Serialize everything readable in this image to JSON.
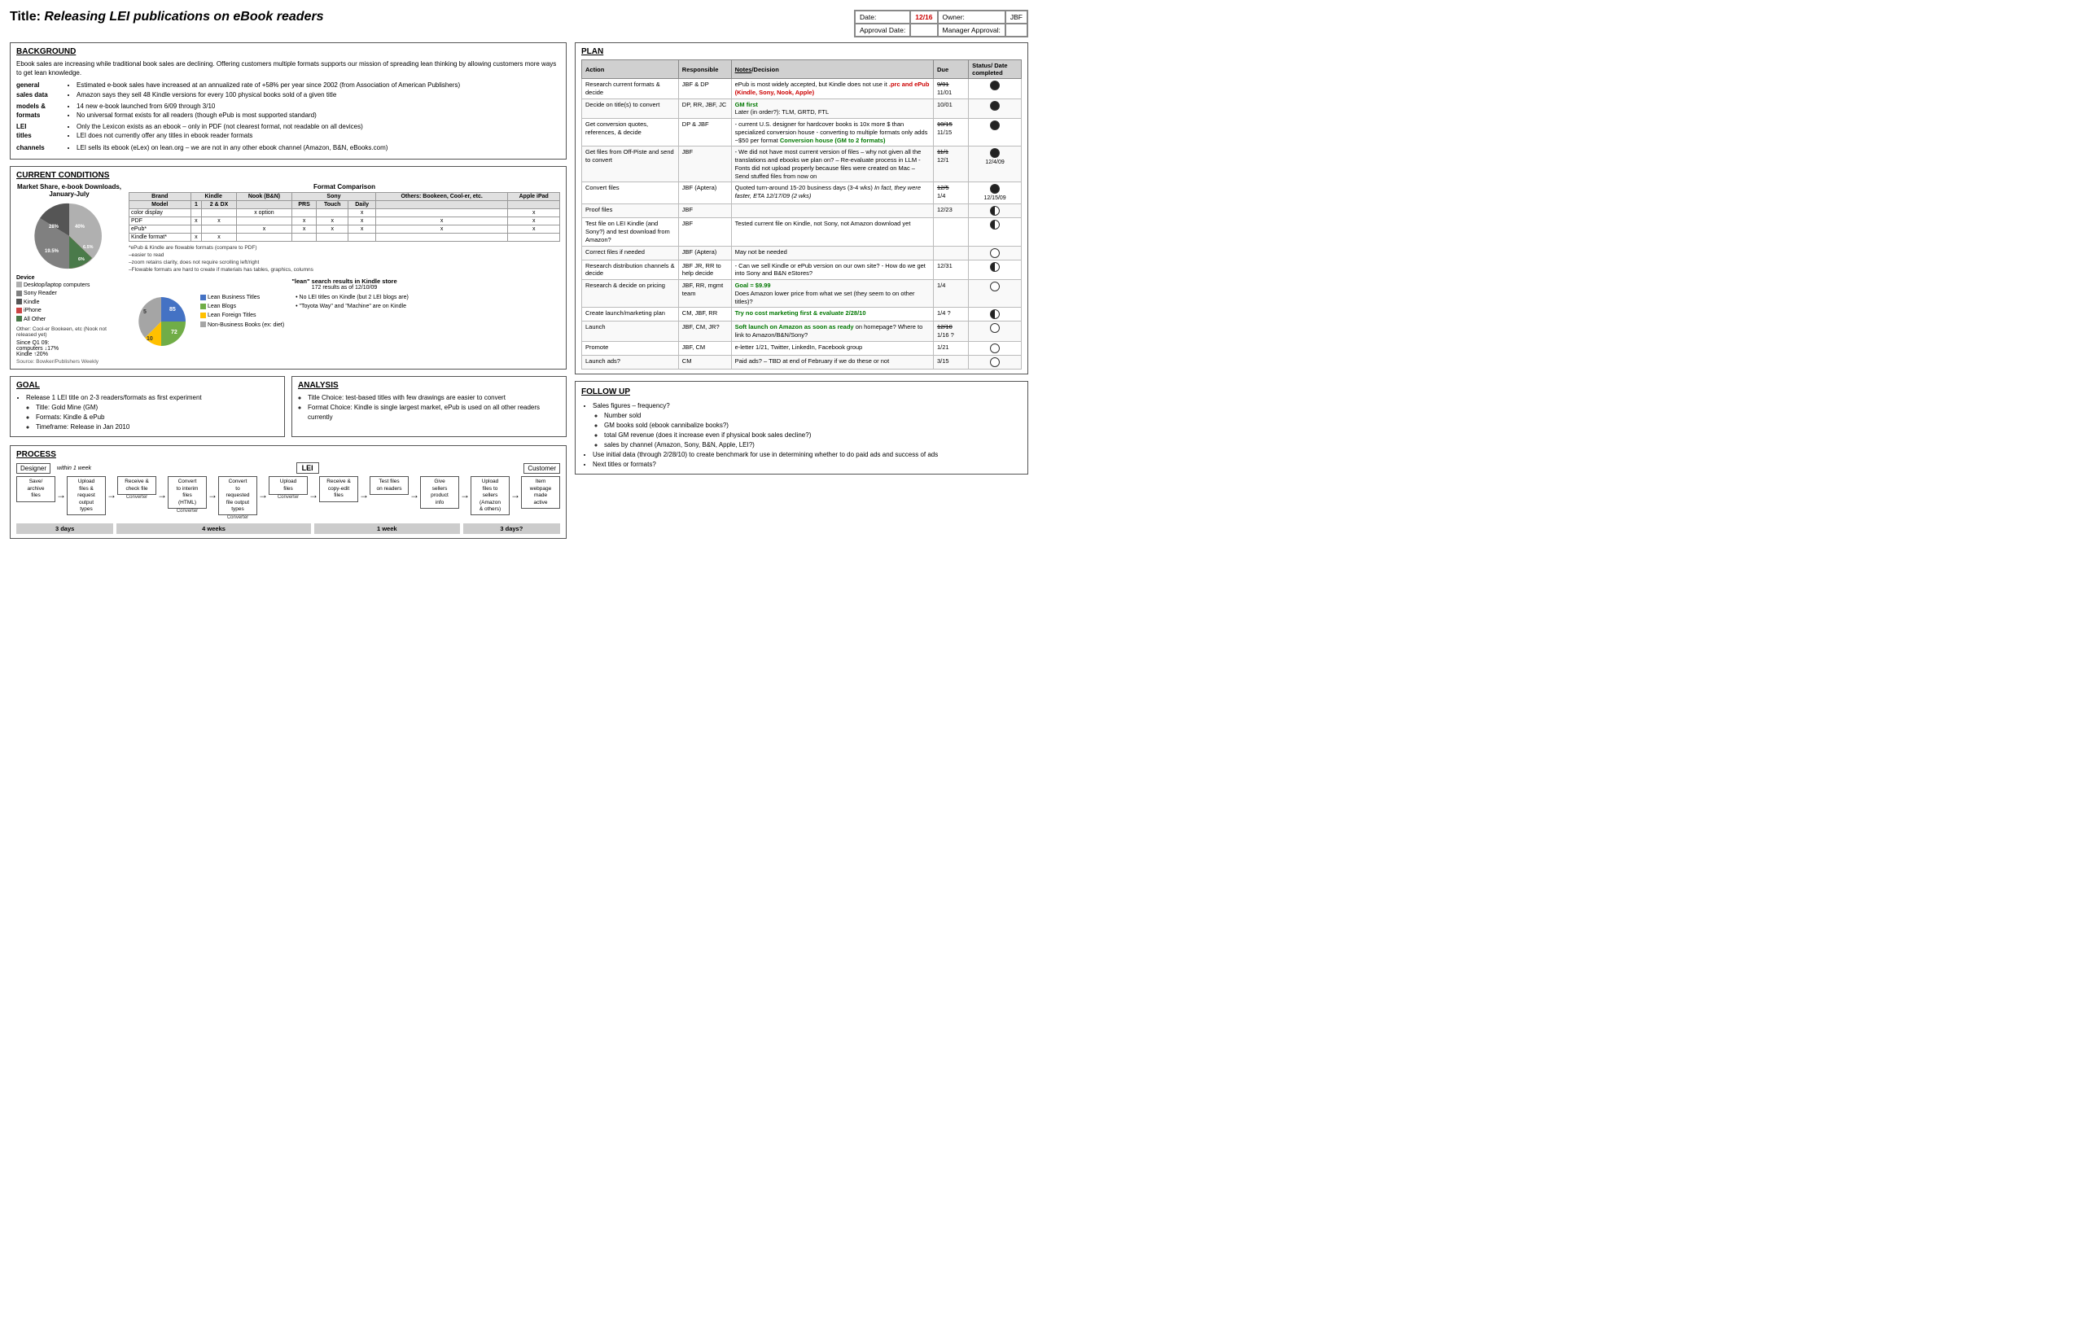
{
  "title": "Title: ",
  "title_italic": "Releasing LEI publications on eBook readers",
  "header": {
    "date_label": "Date:",
    "date_value": "12/16",
    "owner_label": "Owner:",
    "owner_value": "JBF",
    "approval_date_label": "Approval Date:",
    "manager_approval_label": "Manager Approval:"
  },
  "background": {
    "title": "BACKGROUND",
    "intro": "Ebook sales are increasing while traditional book sales are declining. Offering customers multiple formats supports our mission of spreading lean thinking by allowing customers more ways to get lean knowledge.",
    "rows": [
      {
        "label": "general sales data",
        "items": [
          "Estimated e-book sales have increased at an annualized rate of +58% per year since 2002 (from Association of American Publishers)",
          "Amazon says they sell 48 Kindle versions for every 100 physical books sold of a given title"
        ]
      },
      {
        "label": "models & formats",
        "items": [
          "14 new e-book launched from 6/09 through 3/10",
          "No universal format exists for all readers (though ePub is most supported standard)"
        ]
      },
      {
        "label": "LEI titles",
        "items": [
          "Only the Lexicon exists as an ebook – only in PDF (not clearest format, not readable on all devices)",
          "LEI does not currently offer any titles in ebook reader formats"
        ]
      },
      {
        "label": "channels",
        "items": [
          "LEI sells its ebook (eLex) on lean.org – we are not in any other ebook channel (Amazon, B&N, eBooks.com)"
        ]
      }
    ]
  },
  "current_conditions": {
    "title": "CURRENT CONDITIONS",
    "pie_title": "Market Share, e-book Downloads, January-July",
    "pie_data": [
      {
        "label": "Desktop/laptop computers",
        "color": "#b0b0b0",
        "value": "40%",
        "pct": 40
      },
      {
        "label": "Sony Reader",
        "color": "#808080",
        "value": "19.5%",
        "pct": 19.5
      },
      {
        "label": "Kindle",
        "color": "#555",
        "value": "28%",
        "pct": 28
      },
      {
        "label": "iPhone",
        "color": "#cc4444",
        "value": "6.5%",
        "pct": 6.5
      },
      {
        "label": "All Other",
        "color": "#4a7a4a",
        "value": "6%",
        "pct": 6
      }
    ],
    "device_label": "Device",
    "pie_note": "Other: Cool-er Bookeen, etc (Nook not released yet)",
    "since_q1": "Since Q1 09:",
    "computers_change": "computers ↓17%",
    "kindle_change": "Kindle ↑20%",
    "source": "Source: Bowker/Publishers Weekly",
    "format_title": "Format Comparison",
    "format_headers": [
      "Brand",
      "Kindle",
      "Nook (B&N)",
      "Sony",
      "",
      "Others: Bookeen, Cool-er, etc.",
      "Apple iPad"
    ],
    "format_subheaders": [
      "Model",
      "1",
      "2 & DX",
      "",
      "PRS",
      "Touch",
      "Daily",
      "",
      ""
    ],
    "format_rows": [
      {
        "feature": "color display",
        "kindle1": "",
        "kindle2": "",
        "nook": "x option",
        "sony_prs": "",
        "sony_touch": "",
        "sony_daily": "x",
        "others": "",
        "ipad": "x"
      },
      {
        "feature": "PDF",
        "kindle1": "x",
        "kindle2": "x",
        "nook": "",
        "sony_prs": "x",
        "sony_touch": "x",
        "sony_daily": "x",
        "others": "x",
        "ipad": "x"
      },
      {
        "feature": "ePub*",
        "kindle1": "",
        "kindle2": "",
        "nook": "x",
        "sony_prs": "x",
        "sony_touch": "x",
        "sony_daily": "x",
        "others": "x",
        "ipad": "x"
      },
      {
        "feature": "Kindle format*",
        "kindle1": "x",
        "kindle2": "x",
        "nook": "",
        "sony_prs": "",
        "sony_touch": "",
        "sony_daily": "",
        "others": "",
        "ipad": ""
      }
    ],
    "format_note": "*ePub & Kindle are flowable formats (compare to PDF)\n–easier to read\n–zoom retains clarity, does not require scrolling left/right\n–Flowable formats are hard to create if materials has tables, graphics, columns",
    "kindle_search_title": "\"lean\" search results in Kindle store",
    "kindle_search_subtitle": "172 results as of 12/10/09",
    "bar_labels": [
      "Lean Business Titles",
      "Lean Blogs",
      "Lean Foreign Titles",
      "Non-Business Books (ex: diet)"
    ],
    "bar_colors": [
      "#4472c4",
      "#70ad47",
      "#ffc000",
      "#a5a5a5"
    ],
    "bar_values": [
      85,
      72,
      5,
      10
    ],
    "kindle_bullets": [
      "No LEI titles on Kindle (but 2 LEI blogs are)",
      "\"Toyota Way\" and \"Machine\" are on Kindle"
    ]
  },
  "goal": {
    "title": "GOAL",
    "items": [
      "Release 1 LEI title on 2-3 readers/formats as first experiment",
      "Title: Gold Mine (GM)",
      "Formats: Kindle & ePub",
      "Timeframe: Release in Jan 2010"
    ]
  },
  "analysis": {
    "title": "ANALYSIS",
    "items": [
      "Title Choice: test-based titles with few drawings are easier to convert",
      "Format Choice: Kindle is single largest market, ePub is used on all other readers currently"
    ]
  },
  "process": {
    "title": "PROCESS",
    "actors": {
      "designer": "Designer",
      "lei": "LEI",
      "customer": "Customer"
    },
    "within_week": "within 1 week",
    "steps": [
      {
        "label": "Save/ archive files",
        "sub": ""
      },
      {
        "label": "Upload files & request output types",
        "sub": ""
      },
      {
        "label": "Receive & check file",
        "sub": "Converter"
      },
      {
        "label": "Convert to interim files (HTML)",
        "sub": "Converter"
      },
      {
        "label": "Convert to requested file output types",
        "sub": "Converter"
      },
      {
        "label": "Upload files",
        "sub": "Converter"
      },
      {
        "label": "Receive & copy-edit files",
        "sub": ""
      },
      {
        "label": "Test files on readers",
        "sub": ""
      },
      {
        "label": "Give sellers product info",
        "sub": ""
      },
      {
        "label": "Upload files to sellers (Amazon & others)",
        "sub": ""
      },
      {
        "label": "Item webpage made active",
        "sub": ""
      }
    ],
    "durations": [
      {
        "label": "3 days",
        "span": 2
      },
      {
        "label": "4 weeks",
        "span": 4
      },
      {
        "label": "1 week",
        "span": 3
      },
      {
        "label": "3 days?",
        "span": 2
      }
    ]
  },
  "plan": {
    "title": "PLAN",
    "headers": [
      "Action",
      "Responsible",
      "Notes/Decision",
      "Due",
      "Status/Date completed"
    ],
    "rows": [
      {
        "action": "Research current formats & decide",
        "responsible": "JBF & DP",
        "notes": "ePub is most widely accepted, but Kindle does not use it .prc and ePub (Kindle, Sony, Nook, Apple)",
        "due": "9/01 11/01",
        "status": "full"
      },
      {
        "action": "Decide on title(s) to convert",
        "responsible": "DP, RR, JBF, JC",
        "notes": "GM first Later (in order?): TLM, GRTD, FTL",
        "due": "10/01",
        "status": "full"
      },
      {
        "action": "Get conversion quotes, references, & decide",
        "responsible": "DP & JBF",
        "notes": "- current U.S. designer for hardcover books is 10x more $ than specialized conversion house - converting to multiple formats only adds ~$50 per format Conversion house (GM to 2 formats)",
        "due": "10/15 11/15",
        "status": "full"
      },
      {
        "action": "Get files from Off-Piste and send to convert",
        "responsible": "JBF",
        "notes": "- We did not have most current version of files – why not given all the translations and ebooks we plan on? – Re-evaluate process in LLM - Fonts did not upload properly because files were created on Mac – Send stuffed files from now on",
        "due": "11/1 12/1",
        "status": "full",
        "completed": "12/4/09"
      },
      {
        "action": "Convert files",
        "responsible": "JBF (Aptera)",
        "notes": "Quoted turn-around 15-20 business days (3-4 wks) In fact, they were faster, ETA 12/17/09 (2 wks)",
        "due": "12/5 1/4",
        "status": "full",
        "completed": "12/15/09"
      },
      {
        "action": "Proof files",
        "responsible": "JBF",
        "notes": "",
        "due": "12/23",
        "status": "half"
      },
      {
        "action": "Test file on LEI Kindle (and Sony?) and test download from Amazon?",
        "responsible": "JBF",
        "notes": "Tested current file on Kindle, not Sony, not Amazon download yet",
        "due": "",
        "status": "half"
      },
      {
        "action": "Correct files if needed",
        "responsible": "JBF (Aptera)",
        "notes": "May not be needed",
        "due": "",
        "status": "empty"
      },
      {
        "action": "Research distribution channels & decide",
        "responsible": "JBF JR, RR to help decide",
        "notes": "- Can we sell Kindle or ePub version on our own site? - How do we get into Sony and B&N eStores?",
        "due": "12/31",
        "status": "half"
      },
      {
        "action": "Research & decide on pricing",
        "responsible": "JBF, RR, mgmt team",
        "notes": "Goal = $9.99 Does Amazon lower price from what we set (they seem to on other titles)?",
        "due": "1/4",
        "status": "empty"
      },
      {
        "action": "Create launch/marketing plan",
        "responsible": "CM, JBF, RR",
        "notes": "Try no cost marketing first & evaluate 2/28/10",
        "due": "1/4 ?",
        "status": "half"
      },
      {
        "action": "Launch",
        "responsible": "JBF, CM, JR?",
        "notes": "Soft launch on Amazon as soon as ready on homepage? Where to link to Amazon/B&N/Sony?",
        "due": "12/10 1/16 ?",
        "status": "empty"
      },
      {
        "action": "Promote",
        "responsible": "JBF, CM",
        "notes": "e-letter 1/21, Twitter, LinkedIn, Facebook group",
        "due": "1/21",
        "status": "empty"
      },
      {
        "action": "Launch ads?",
        "responsible": "CM",
        "notes": "Paid ads? – TBD at end of February if we do these or not",
        "due": "3/15",
        "status": "empty"
      }
    ]
  },
  "follow_up": {
    "title": "FOLLOW UP",
    "items": [
      {
        "text": "Sales figures – frequency?",
        "sub_items": [
          "Number sold",
          "GM books sold (ebook cannibalize books?)",
          "total GM revenue (does it increase even if physical book sales decline?)",
          "sales by channel (Amazon, Sony, B&N, Apple, LEI?)"
        ]
      },
      {
        "text": "Use initial data (through 2/28/10) to create benchmark for use in determining whether to do paid ads and success of ads",
        "sub_items": []
      },
      {
        "text": "Next titles or formats?",
        "sub_items": []
      }
    ]
  }
}
